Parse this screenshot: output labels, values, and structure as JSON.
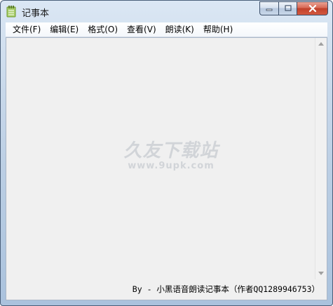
{
  "window": {
    "title": "记事本",
    "icon": "notepad-icon",
    "accent_color": "#b9cde3",
    "close_color": "#c1412b"
  },
  "caption": {
    "minimize_icon": "minimize-icon",
    "maximize_icon": "maximize-icon",
    "close_icon": "close-icon"
  },
  "menu": {
    "items": [
      {
        "label": "文件(F)"
      },
      {
        "label": "编辑(E)"
      },
      {
        "label": "格式(O)"
      },
      {
        "label": "查看(V)"
      },
      {
        "label": "朗读(K)"
      },
      {
        "label": "帮助(H)"
      }
    ]
  },
  "editor": {
    "content": ""
  },
  "status": {
    "text": "By - 小黑语音朗读记事本（作者QQ1289946753）"
  },
  "watermark": {
    "main": "久友下载站",
    "sub": "www.9upk.com"
  }
}
